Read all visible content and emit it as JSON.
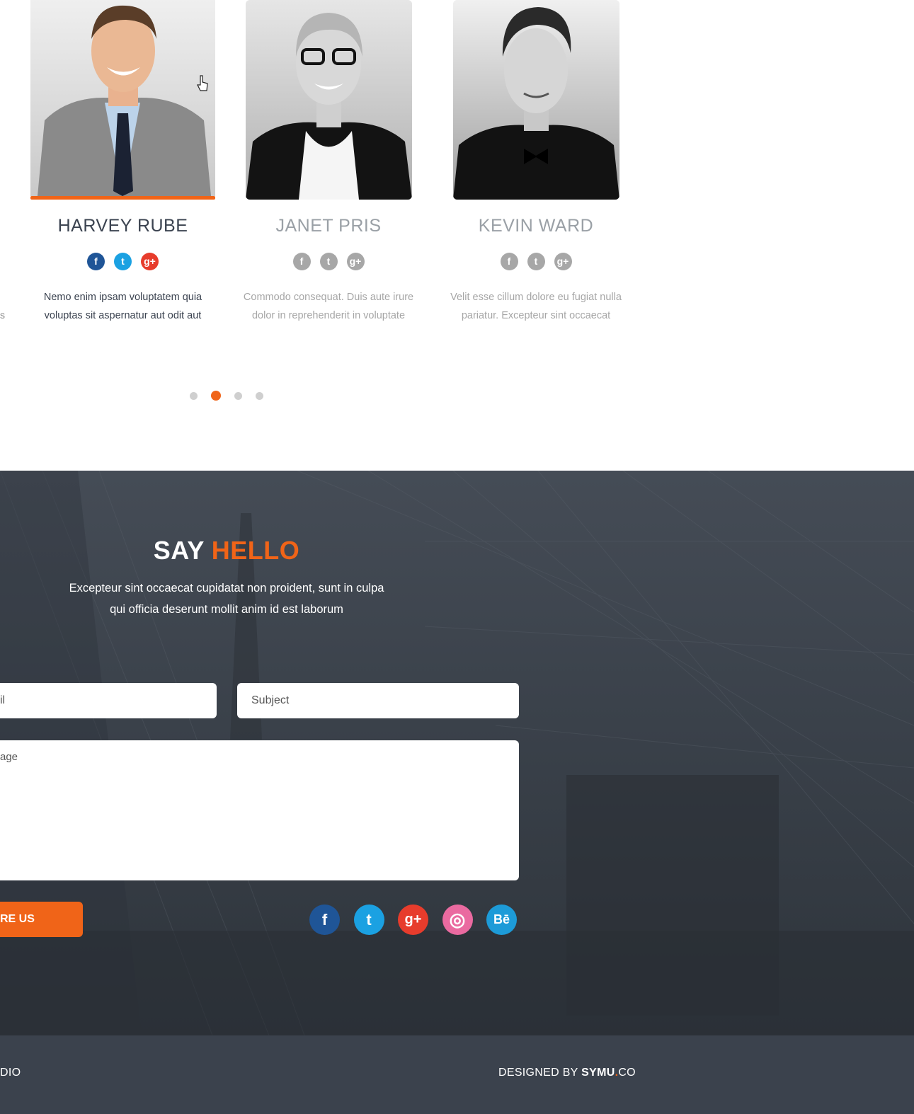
{
  "team": {
    "edge_fragment": "s",
    "members": [
      {
        "name": "HARVEY RUBE",
        "desc_line1": "Nemo enim ipsam voluptatem quia",
        "desc_line2": "voluptas sit aspernatur aut odit aut",
        "active": true
      },
      {
        "name": "JANET PRIS",
        "desc_line1": "Commodo consequat. Duis aute irure",
        "desc_line2": "dolor in reprehenderit in voluptate",
        "active": false
      },
      {
        "name": "KEVIN WARD",
        "desc_line1": "Velit esse cillum dolore eu fugiat nulla",
        "desc_line2": "pariatur. Excepteur sint occaecat",
        "active": false
      }
    ],
    "social_icons": [
      "facebook-icon",
      "twitter-icon",
      "google-plus-icon"
    ],
    "social_glyphs": {
      "facebook": "f",
      "twitter": "t",
      "google_plus": "g+"
    },
    "carousel": {
      "page_count": 4,
      "active_index": 1
    }
  },
  "contact": {
    "title_plain": "SAY",
    "title_accent": "HELLO",
    "intro_line1": "Excepteur sint occaecat cupidatat non proident, sunt in culpa",
    "intro_line2": "qui officia deserunt mollit anim id est laborum",
    "email_placeholder": "il",
    "subject_placeholder": "Subject",
    "message_placeholder": "age",
    "send_label": "RE US",
    "social": [
      {
        "icon": "facebook-icon",
        "glyph": "f",
        "color": "#1f5597"
      },
      {
        "icon": "twitter-icon",
        "glyph": "t",
        "color": "#1ba1e2"
      },
      {
        "icon": "google-plus-icon",
        "glyph": "g+",
        "color": "#e73c2c"
      },
      {
        "icon": "dribbble-icon",
        "glyph": "◎",
        "color": "#ea6aa0"
      },
      {
        "icon": "behance-icon",
        "glyph": "Bē",
        "color": "#1d9bd8"
      }
    ]
  },
  "footer": {
    "left_text": "DIO",
    "designed_by": "DESIGNED BY",
    "brand": "SYMU",
    "brand_dot": ".",
    "brand_suffix": "CO"
  },
  "colors": {
    "accent": "#f06418",
    "dark_text": "#3b4350",
    "muted_text": "#a6a6a6",
    "footer_bg": "#3b424d",
    "contact_bg": "#3a414a"
  }
}
